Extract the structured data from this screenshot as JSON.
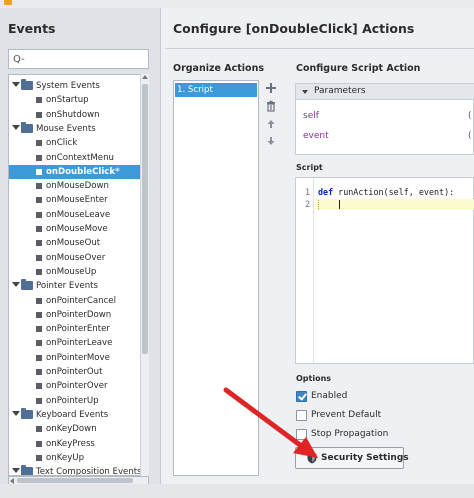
{
  "left": {
    "title": "Events",
    "search_placeholder": "Q-",
    "tree": [
      {
        "label": "System Events",
        "type": "folder",
        "level": 0
      },
      {
        "label": "onStartup",
        "type": "leaf",
        "level": 1
      },
      {
        "label": "onShutdown",
        "type": "leaf",
        "level": 1
      },
      {
        "label": "Mouse Events",
        "type": "folder",
        "level": 0
      },
      {
        "label": "onClick",
        "type": "leaf",
        "level": 1
      },
      {
        "label": "onContextMenu",
        "type": "leaf",
        "level": 1
      },
      {
        "label": "onDoubleClick*",
        "type": "leaf",
        "level": 1,
        "selected": true
      },
      {
        "label": "onMouseDown",
        "type": "leaf",
        "level": 1
      },
      {
        "label": "onMouseEnter",
        "type": "leaf",
        "level": 1
      },
      {
        "label": "onMouseLeave",
        "type": "leaf",
        "level": 1
      },
      {
        "label": "onMouseMove",
        "type": "leaf",
        "level": 1
      },
      {
        "label": "onMouseOut",
        "type": "leaf",
        "level": 1
      },
      {
        "label": "onMouseOver",
        "type": "leaf",
        "level": 1
      },
      {
        "label": "onMouseUp",
        "type": "leaf",
        "level": 1
      },
      {
        "label": "Pointer Events",
        "type": "folder",
        "level": 0
      },
      {
        "label": "onPointerCancel",
        "type": "leaf",
        "level": 1
      },
      {
        "label": "onPointerDown",
        "type": "leaf",
        "level": 1
      },
      {
        "label": "onPointerEnter",
        "type": "leaf",
        "level": 1
      },
      {
        "label": "onPointerLeave",
        "type": "leaf",
        "level": 1
      },
      {
        "label": "onPointerMove",
        "type": "leaf",
        "level": 1
      },
      {
        "label": "onPointerOut",
        "type": "leaf",
        "level": 1
      },
      {
        "label": "onPointerOver",
        "type": "leaf",
        "level": 1
      },
      {
        "label": "onPointerUp",
        "type": "leaf",
        "level": 1
      },
      {
        "label": "Keyboard Events",
        "type": "folder",
        "level": 0
      },
      {
        "label": "onKeyDown",
        "type": "leaf",
        "level": 1
      },
      {
        "label": "onKeyPress",
        "type": "leaf",
        "level": 1
      },
      {
        "label": "onKeyUp",
        "type": "leaf",
        "level": 1
      },
      {
        "label": "Text Composition Events",
        "type": "folder",
        "level": 0
      }
    ]
  },
  "right": {
    "title": "Configure [onDoubleClick] Actions",
    "organize_title": "Organize Actions",
    "actions": [
      "1. Script"
    ],
    "script_action_title": "Configure Script Action",
    "parameters_label": "Parameters",
    "params": [
      {
        "name": "self",
        "value": "("
      },
      {
        "name": "event",
        "value": "("
      }
    ],
    "script_label": "Script",
    "code": {
      "line_numbers": [
        "1",
        "2"
      ],
      "keyword": "def",
      "signature": " runAction(self, event):"
    },
    "options_label": "Options",
    "options": [
      {
        "label": "Enabled",
        "checked": true
      },
      {
        "label": "Prevent Default",
        "checked": false
      },
      {
        "label": "Stop Propagation",
        "checked": false
      }
    ],
    "security_button": "Security Settings"
  },
  "colors": {
    "selection": "#3d9ad8",
    "arrow": "#e02424",
    "keyword": "#0b28b8",
    "param_name": "#8a2f9e"
  },
  "icons": {
    "add": "plus-icon",
    "delete": "trash-icon",
    "move_up": "arrow-up-icon",
    "move_down": "arrow-down-icon",
    "security": "shield-icon"
  }
}
